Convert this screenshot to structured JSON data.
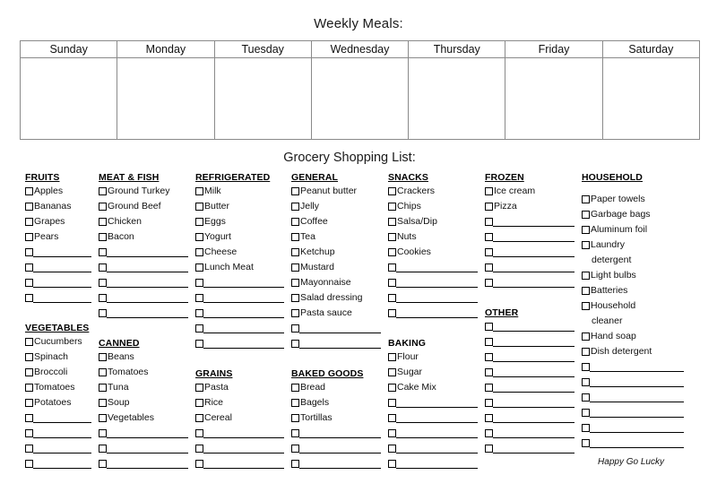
{
  "meals": {
    "title": "Weekly Meals:",
    "days": [
      "Sunday",
      "Monday",
      "Tuesday",
      "Wednesday",
      "Thursday",
      "Friday",
      "Saturday"
    ]
  },
  "grocery": {
    "title": "Grocery Shopping List:",
    "columns": [
      {
        "groups": [
          {
            "heading": "FRUITS",
            "items": [
              "Apples",
              "Bananas",
              "Grapes",
              "Pears"
            ],
            "blanks": 4
          },
          {
            "heading": "VEGETABLES",
            "items": [
              "Cucumbers",
              "Spinach",
              "Broccoli",
              "Tomatoes",
              "Potatoes"
            ],
            "blanks": 4
          }
        ]
      },
      {
        "groups": [
          {
            "heading": "MEAT & FISH",
            "items": [
              "Ground Turkey",
              "Ground Beef",
              "Chicken",
              "Bacon"
            ],
            "blanks": 5
          },
          {
            "heading": "CANNED",
            "items": [
              "Beans",
              "Tomatoes",
              "Tuna",
              "Soup",
              "Vegetables"
            ],
            "blanks": 3
          }
        ]
      },
      {
        "groups": [
          {
            "heading": "REFRIGERATED",
            "items": [
              "Milk",
              "Butter",
              "Eggs",
              "Yogurt",
              "Cheese",
              "Lunch Meat"
            ],
            "blanks": 5
          },
          {
            "heading": "GRAINS",
            "items": [
              "Pasta",
              "Rice",
              "Cereal"
            ],
            "blanks": 3
          }
        ]
      },
      {
        "groups": [
          {
            "heading": "GENERAL",
            "items": [
              "Peanut butter",
              "Jelly",
              "Coffee",
              "Tea",
              "Ketchup",
              "Mustard",
              "Mayonnaise",
              "Salad dressing",
              "Pasta sauce"
            ],
            "blanks": 2
          },
          {
            "heading": "BAKED GOODS",
            "items": [
              "Bread",
              "Bagels",
              "Tortillas"
            ],
            "blanks": 3
          }
        ]
      },
      {
        "groups": [
          {
            "heading": "SNACKS",
            "items": [
              "Crackers",
              "Chips",
              "Salsa/Dip",
              "Nuts",
              "Cookies"
            ],
            "blanks": 4
          },
          {
            "heading": "BAKING",
            "underline": false,
            "items": [
              "Flour",
              "Sugar",
              "Cake Mix"
            ],
            "blanks": 5
          }
        ]
      },
      {
        "groups": [
          {
            "heading": "FROZEN",
            "items": [
              "Ice cream",
              "Pizza"
            ],
            "blanks": 5
          },
          {
            "heading": "OTHER",
            "items": [],
            "blanks": 9
          }
        ]
      },
      {
        "groups": [
          {
            "heading": "HOUSEHOLD",
            "head_spacer": true,
            "items": [
              "Paper towels",
              "Garbage bags",
              "Aluminum foil",
              "Laundry",
              "Light bulbs",
              "Batteries",
              "Household",
              "Hand soap",
              "Dish detergent"
            ],
            "continuations": {
              "3": "detergent",
              "6": "cleaner"
            },
            "blanks": 6
          }
        ],
        "credit": "Happy Go Lucky"
      }
    ]
  },
  "colors": {
    "text": "#111111",
    "table_border": "#8a8a8a",
    "box_border": "#000000",
    "background": "#ffffff"
  }
}
